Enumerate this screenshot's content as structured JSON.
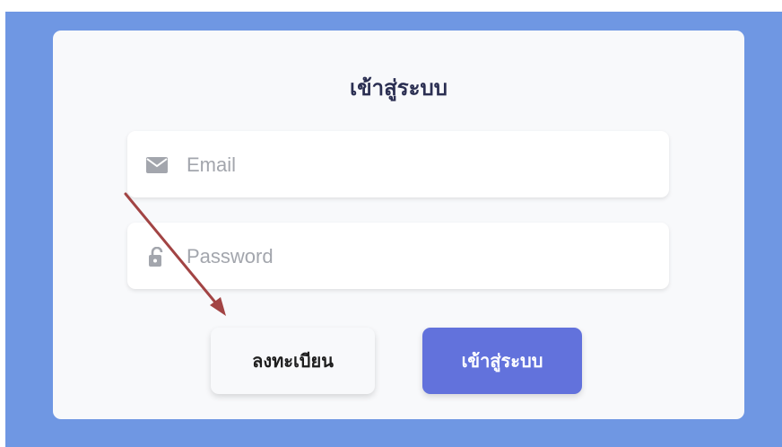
{
  "login_form": {
    "title": "เข้าสู่ระบบ",
    "email": {
      "placeholder": "Email",
      "value": "",
      "icon": "envelope-icon"
    },
    "password": {
      "placeholder": "Password",
      "value": "",
      "icon": "unlock-icon"
    },
    "register_label": "ลงทะเบียน",
    "login_label": "เข้าสู่ระบบ"
  },
  "annotation": {
    "icon": "arrow-annotation",
    "color": "#a24444"
  },
  "colors": {
    "background": "#6f97e3",
    "card": "#f8f9fb",
    "primary": "#6272dc",
    "title": "#2b2f52",
    "icon": "#a3a6ad"
  }
}
